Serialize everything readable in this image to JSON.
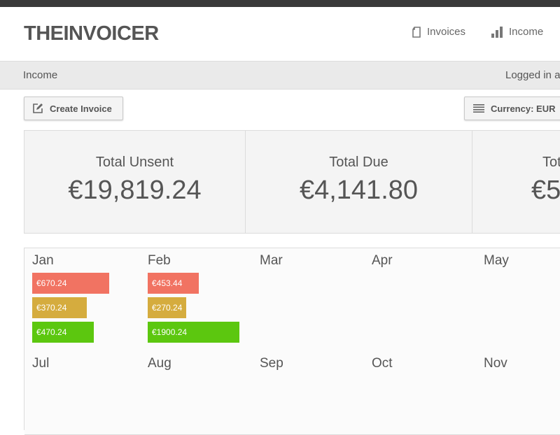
{
  "app": {
    "logo": "THEINVOICER"
  },
  "nav": [
    {
      "label": "Invoices",
      "icon": "document-icon"
    },
    {
      "label": "Income",
      "icon": "bar-chart-icon"
    }
  ],
  "subbar": {
    "breadcrumb": "Income",
    "login_text": "Logged in a"
  },
  "toolbar": {
    "create_invoice": "Create Invoice",
    "currency": "Currency: EUR"
  },
  "summary": [
    {
      "label": "Total Unsent",
      "value": "€19,819.24"
    },
    {
      "label": "Total Due",
      "value": "€4,141.80"
    },
    {
      "label": "Tot",
      "value": "€5"
    }
  ],
  "colors": {
    "unsent": "#f17362",
    "due": "#d5ac3e",
    "paid": "#5cc70f"
  },
  "months": [
    {
      "name": "Jan",
      "bars": [
        {
          "label": "€670.24",
          "value": 670.24,
          "status": "unsent"
        },
        {
          "label": "€370.24",
          "value": 370.24,
          "status": "due"
        },
        {
          "label": "€470.24",
          "value": 470.24,
          "status": "paid"
        }
      ]
    },
    {
      "name": "Feb",
      "bars": [
        {
          "label": "€453.44",
          "value": 453.44,
          "status": "unsent"
        },
        {
          "label": "€270.24",
          "value": 270.24,
          "status": "due"
        },
        {
          "label": "€1900.24",
          "value": 1900.24,
          "status": "paid"
        }
      ]
    },
    {
      "name": "Mar",
      "bars": []
    },
    {
      "name": "Apr",
      "bars": []
    },
    {
      "name": "May",
      "bars": []
    },
    {
      "name": "Jul",
      "bars": []
    },
    {
      "name": "Aug",
      "bars": []
    },
    {
      "name": "Sep",
      "bars": []
    },
    {
      "name": "Oct",
      "bars": []
    },
    {
      "name": "Nov",
      "bars": []
    }
  ]
}
